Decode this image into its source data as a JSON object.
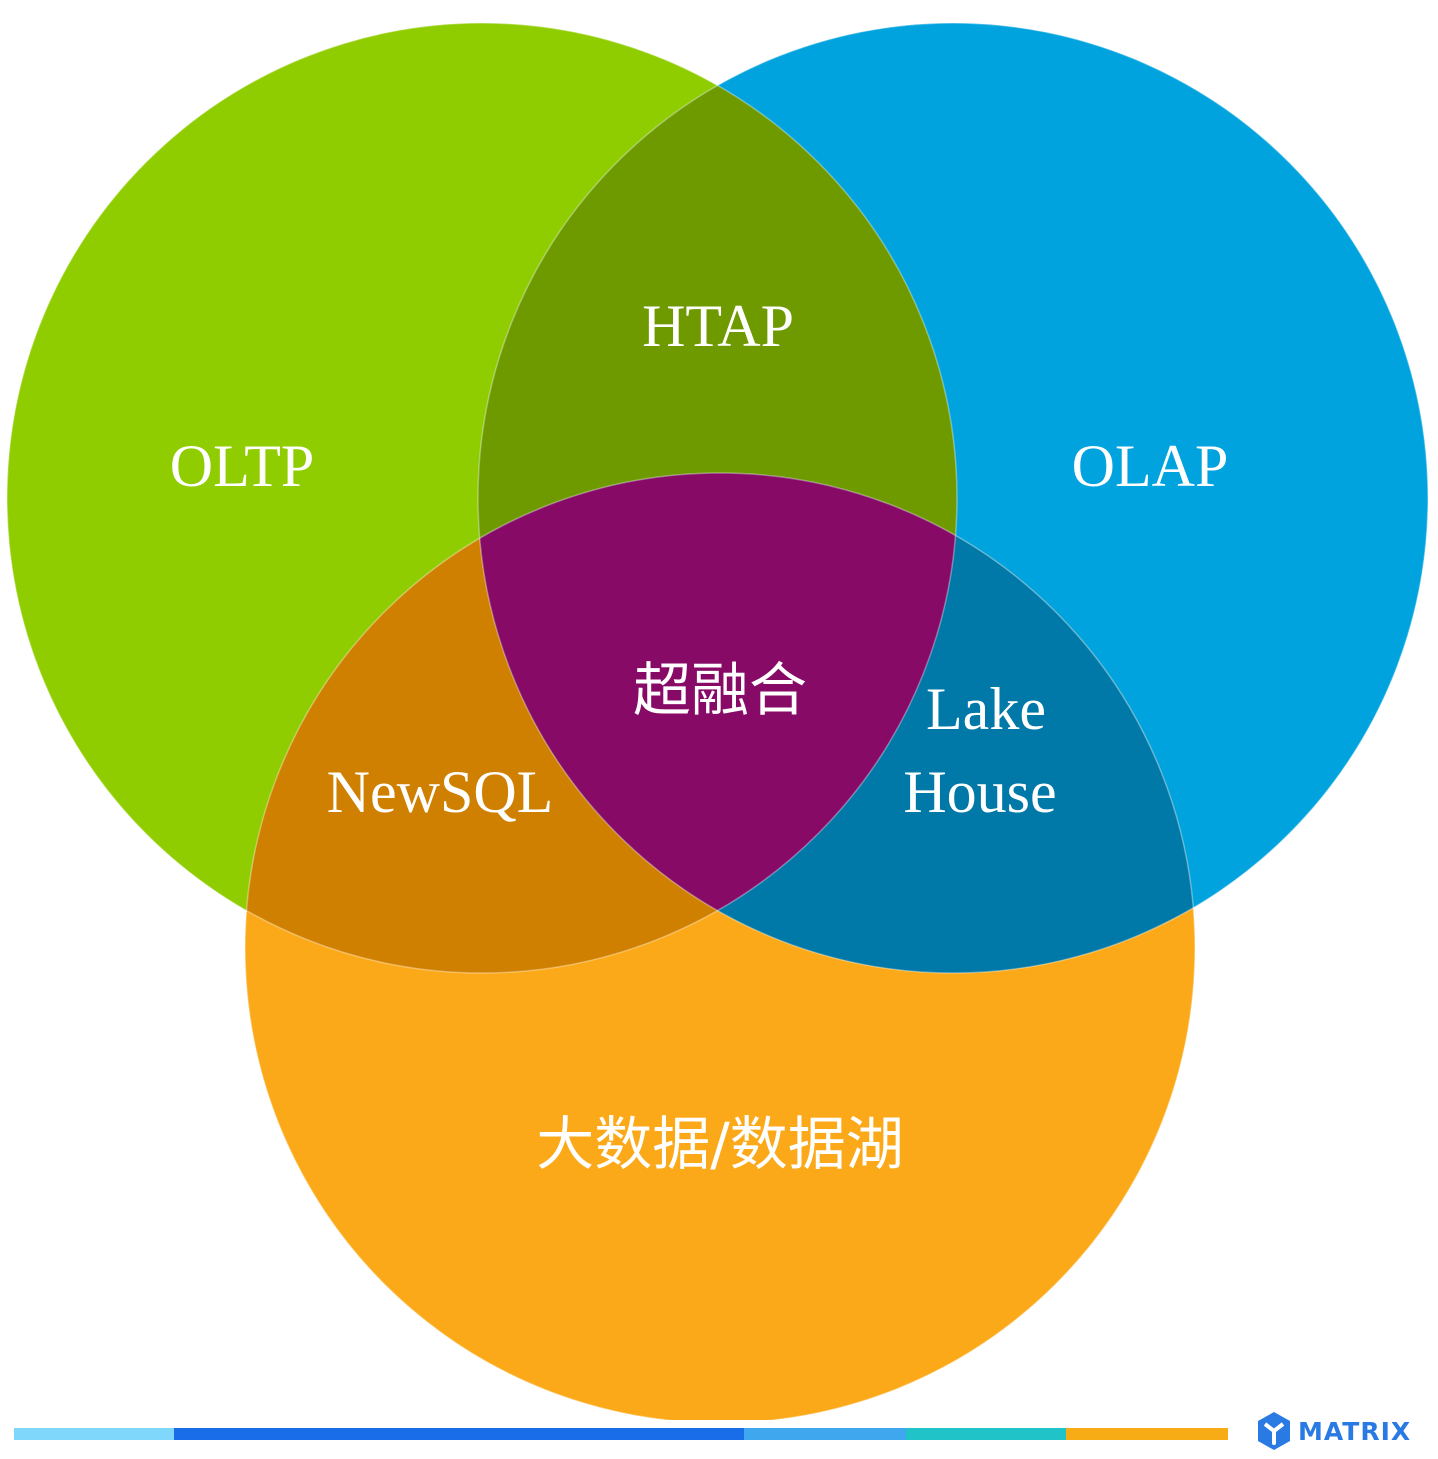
{
  "diagram": {
    "sets": [
      {
        "id": "oltp",
        "label": "OLTP",
        "color": "#8fcd00"
      },
      {
        "id": "olap",
        "label": "OLAP",
        "color": "#00a3de"
      },
      {
        "id": "bigdata",
        "label": "大数据/数据湖",
        "color": "#fba919"
      }
    ],
    "intersections": {
      "oltp_olap": {
        "label": "HTAP",
        "color": "#6e9a00"
      },
      "oltp_bigdata": {
        "label": "NewSQL",
        "color": "#d08000"
      },
      "olap_bigdata": {
        "label_line1": "Lake",
        "label_line2": "House",
        "color": "#0078a8"
      },
      "all": {
        "label": "超融合",
        "color": "#870a67"
      }
    }
  },
  "footer": {
    "bar_colors": [
      "#7fd7fb",
      "#1a6de8",
      "#3ea7ee",
      "#20c3c8",
      "#f7ab14"
    ],
    "brand_text": "MATRIX",
    "brand_color": "#2a7ae4"
  }
}
